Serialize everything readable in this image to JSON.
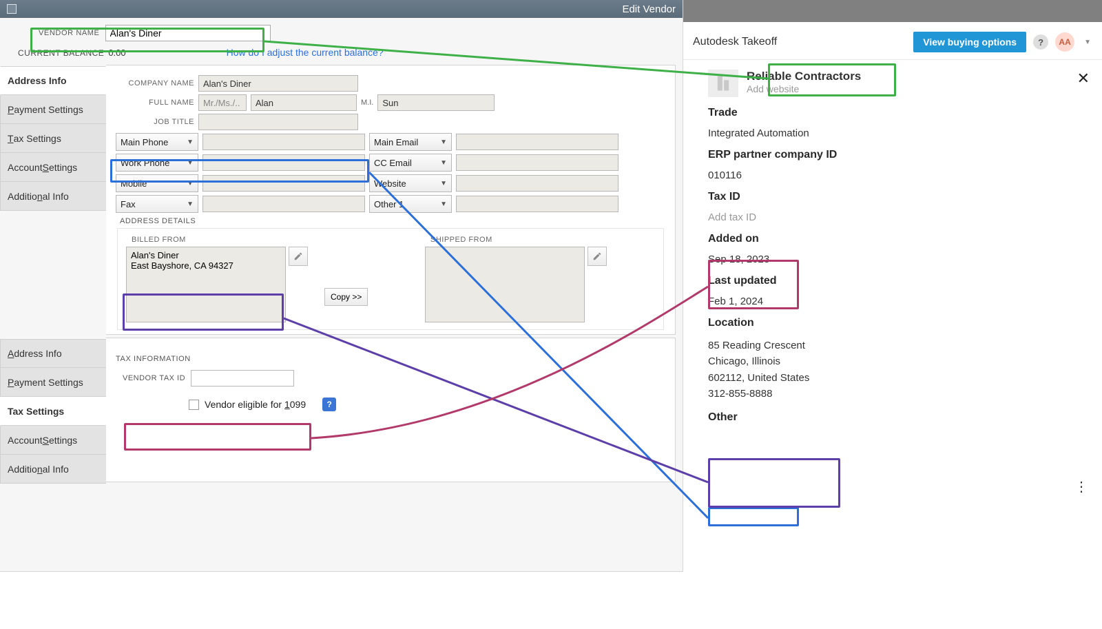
{
  "colors": {
    "green": "#3eb048",
    "blue": "#2d6fd8",
    "purple": "#5c3fa8",
    "magenta": "#b23a6b"
  },
  "window": {
    "title": "Edit Vendor"
  },
  "vendorName": {
    "label": "VENDOR NAME",
    "value": "Alan's Diner"
  },
  "currentBalance": {
    "label": "CURRENT BALANCE",
    "value": "0.00",
    "adjustLink": "How do I adjust the current balance?"
  },
  "tabs1": [
    {
      "label": "Address Info",
      "active": true,
      "underlineIndex": null
    },
    {
      "label": "Payment Settings",
      "underline": "P"
    },
    {
      "label": "Tax Settings",
      "underline": "T"
    },
    {
      "label": "Account Settings",
      "underline": "S",
      "underlinePos": "end"
    },
    {
      "label": "Additional Info",
      "underline": "n"
    }
  ],
  "tabs2": [
    {
      "label": "Address Info",
      "underline": "A"
    },
    {
      "label": "Payment Settings",
      "underline": "P"
    },
    {
      "label": "Tax Settings",
      "active": true
    },
    {
      "label": "Account Settings",
      "underline": "S",
      "underlinePos": "end"
    },
    {
      "label": "Additional Info",
      "underline": "n"
    }
  ],
  "form": {
    "companyNameLabel": "COMPANY NAME",
    "companyName": "Alan's Diner",
    "fullNameLabel": "FULL NAME",
    "salutation": "Mr./Ms./..",
    "firstName": "Alan",
    "middleLabel": "M.I.",
    "middle": "",
    "lastName": "Sun",
    "jobTitleLabel": "JOB TITLE",
    "jobTitle": "",
    "phoneCombos": [
      "Main Phone",
      "Work Phone",
      "Mobile",
      "Fax"
    ],
    "emailCombos": [
      "Main Email",
      "CC Email",
      "Website",
      "Other 1"
    ],
    "addressHeader": "ADDRESS DETAILS",
    "billedFrom": "BILLED FROM",
    "shippedFrom": "SHIPPED FROM",
    "billedAddress": "Alan's Diner\nEast Bayshore, CA 94327",
    "shippedAddress": "",
    "copyBtn": "Copy >>"
  },
  "tax": {
    "header": "TAX INFORMATION",
    "idLabel": "VENDOR TAX ID",
    "idValue": "",
    "eligible": "Vendor eligible for 1099",
    "eligibleUnderline": "1"
  },
  "right": {
    "appName": "Autodesk Takeoff",
    "buyBtn": "View buying options",
    "avatar": "AA",
    "vendor": "Reliable Contractors",
    "addWebsite": "Add website",
    "tradeLabel": "Trade",
    "trade": "Integrated Automation",
    "erpLabel": "ERP partner company ID",
    "erp": "010116",
    "taxIdLabel": "Tax ID",
    "taxId": "Add tax ID",
    "addedLabel": "Added on",
    "added": "Sep 18, 2023",
    "updatedLabel": "Last updated",
    "updated": "Feb 1, 2024",
    "locationLabel": "Location",
    "addr1": "85 Reading Crescent",
    "addr2": "Chicago, Illinois",
    "addr3": "602112, United States",
    "phone": "312-855-8888",
    "other": "Other"
  }
}
